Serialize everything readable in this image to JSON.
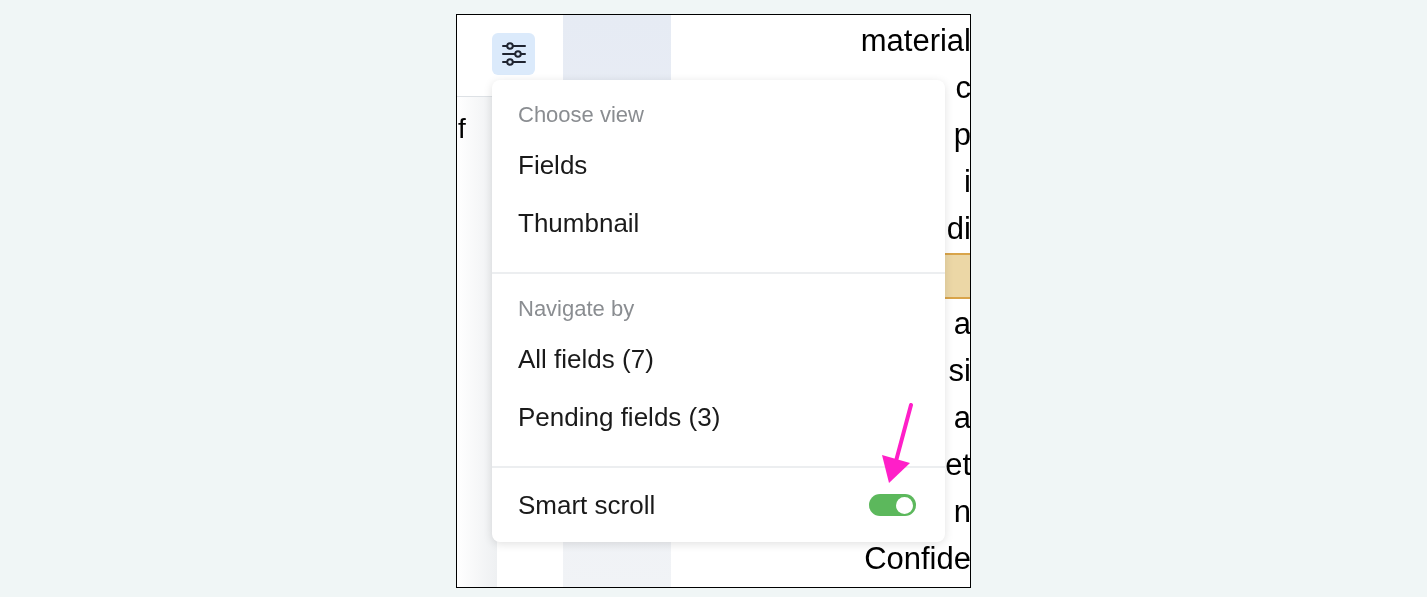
{
  "left_fragment": "f",
  "document": {
    "lines": [
      {
        "kind": "text",
        "text": "material"
      },
      {
        "kind": "text",
        "text": "c"
      },
      {
        "kind": "text",
        "text": "p"
      },
      {
        "kind": "text",
        "text": "i"
      },
      {
        "kind": "text",
        "text": "di"
      },
      {
        "kind": "highlight"
      },
      {
        "kind": "text",
        "text": "a"
      },
      {
        "kind": "text",
        "text": "si"
      },
      {
        "kind": "text",
        "text": "a"
      },
      {
        "kind": "text",
        "text": "et"
      },
      {
        "kind": "text",
        "text": "n"
      },
      {
        "kind": "text",
        "text": "Confide"
      }
    ]
  },
  "menu": {
    "sections": [
      {
        "heading": "Choose view",
        "items": [
          {
            "kind": "option",
            "label": "Fields"
          },
          {
            "kind": "option",
            "label": "Thumbnail"
          }
        ]
      },
      {
        "heading": "Navigate by",
        "items": [
          {
            "kind": "option",
            "label": "All fields (7)"
          },
          {
            "kind": "option",
            "label": "Pending fields (3)"
          }
        ]
      },
      {
        "items": [
          {
            "kind": "toggle",
            "label": "Smart scroll",
            "on": true
          }
        ]
      }
    ]
  }
}
